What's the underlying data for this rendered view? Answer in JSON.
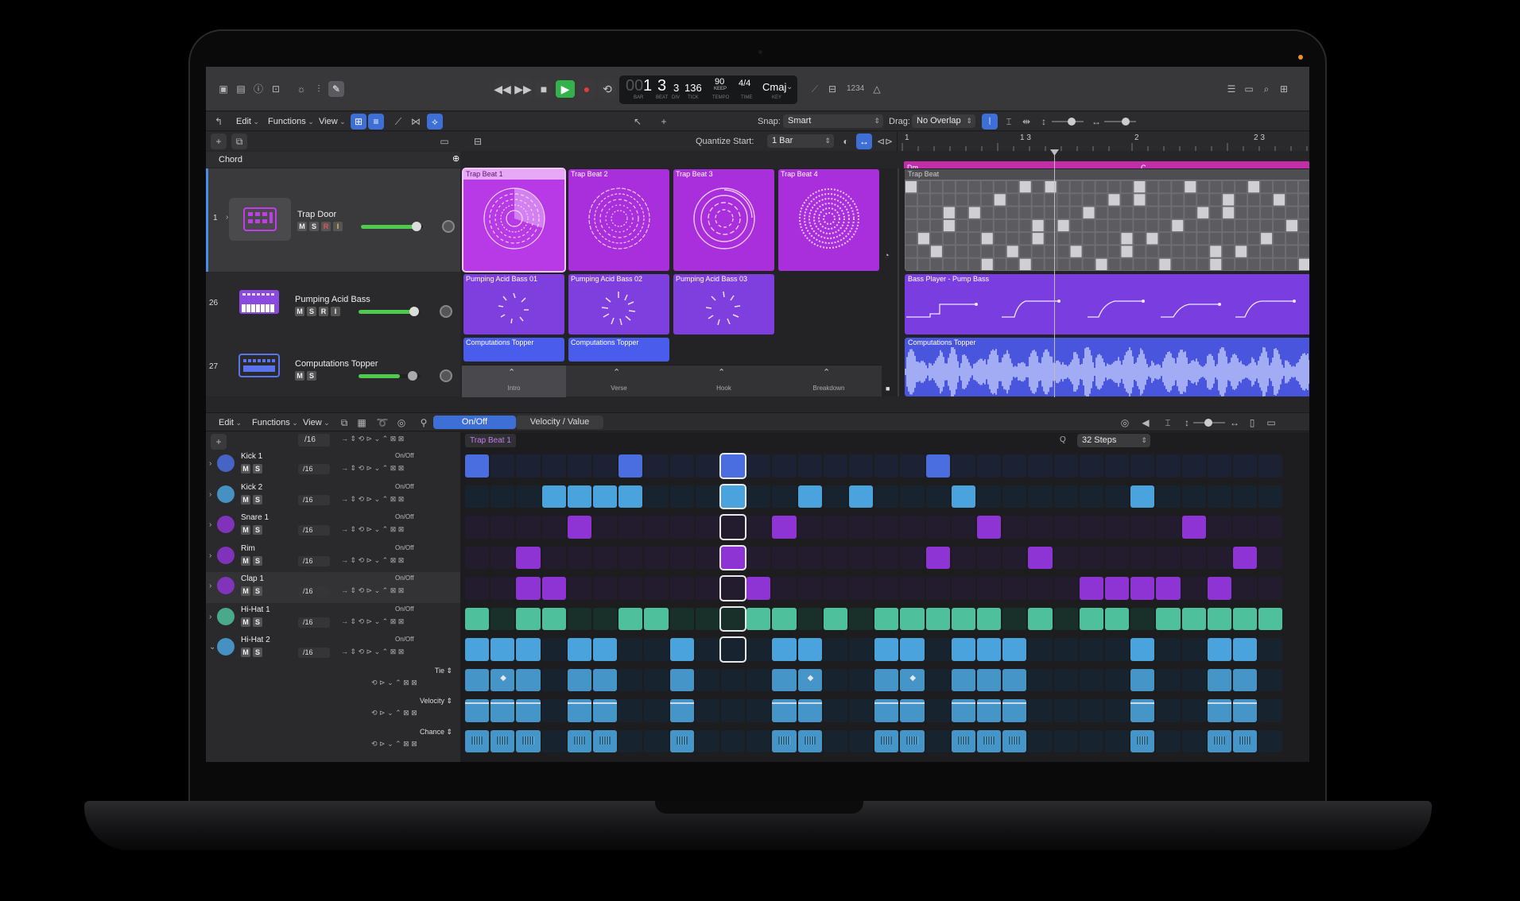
{
  "transport": {
    "position_dim": "00",
    "bar": "1",
    "beat": "3",
    "div": "3",
    "tick": "136",
    "bar_lbl": "BAR",
    "beat_lbl": "BEAT",
    "div_lbl": "DIV",
    "tick_lbl": "TICK",
    "tempo": "90",
    "tempo_mode": "KEEP",
    "tempo_lbl": "TEMPO",
    "time_sig": "4/4",
    "time_lbl": "TIME",
    "key": "Cmaj",
    "key_lbl": "KEY",
    "counter": "1234"
  },
  "toolbar": {
    "edit": "Edit",
    "functions": "Functions",
    "view": "View",
    "snap_label": "Snap:",
    "snap_value": "Smart",
    "drag_label": "Drag:",
    "drag_value": "No Overlap",
    "quantize_label": "Quantize Start:",
    "quantize_value": "1 Bar"
  },
  "chord_track": {
    "label": "Chord",
    "chords": [
      "Dm",
      "C"
    ]
  },
  "ruler": {
    "marks": [
      "1",
      "1 3",
      "2",
      "2 3"
    ]
  },
  "tracks": [
    {
      "number": "1",
      "name": "Trap Door",
      "buttons": [
        "M",
        "S",
        "R",
        "I"
      ],
      "color": "#c03ee8"
    },
    {
      "number": "26",
      "name": "Pumping Acid Bass",
      "buttons": [
        "M",
        "S",
        "R",
        "I"
      ],
      "color": "#8a4ae0"
    },
    {
      "number": "27",
      "name": "Computations Topper",
      "buttons": [
        "M",
        "S"
      ],
      "color": "#5a74ee"
    }
  ],
  "live_loops": {
    "row1": [
      "Trap Beat 1",
      "Trap Beat 2",
      "Trap Beat 3",
      "Trap Beat 4"
    ],
    "row2": [
      "Pumping Acid Bass 01",
      "Pumping Acid Bass 02",
      "Pumping Acid Bass 03"
    ],
    "row3": [
      "Computations Topper",
      "Computations Topper"
    ],
    "scenes": [
      "Intro",
      "Verse",
      "Hook",
      "Breakdown"
    ]
  },
  "regions": {
    "trap": "Trap Beat",
    "bass": "Bass Player - Pump Bass",
    "topper": "Computations Topper"
  },
  "step_editor": {
    "edit": "Edit",
    "functions": "Functions",
    "view": "View",
    "mode_on": "On/Off",
    "mode_vel": "Velocity / Value",
    "pattern_name": "Trap Beat 1",
    "steps": "32 Steps",
    "q_label": "Q",
    "rate": "/16",
    "sub_lanes": [
      "Tie",
      "Velocity",
      "Chance"
    ]
  },
  "rows": [
    {
      "name": "Kick 1",
      "mode": "On/Off",
      "color": "#4a6ee0",
      "off": "#1c2233",
      "steps": [
        0,
        6,
        10,
        18
      ]
    },
    {
      "name": "Kick 2",
      "mode": "On/Off",
      "color": "#4aa3dc",
      "off": "#172430",
      "steps": [
        3,
        4,
        5,
        6,
        10,
        13,
        15,
        19,
        26
      ]
    },
    {
      "name": "Snare 1",
      "mode": "On/Off",
      "color": "#8f34d4",
      "off": "#231b2e",
      "steps": [
        4,
        12,
        20,
        28
      ]
    },
    {
      "name": "Rim",
      "mode": "On/Off",
      "color": "#8f34d4",
      "off": "#231b2e",
      "steps": [
        2,
        10,
        18,
        22,
        30
      ]
    },
    {
      "name": "Clap 1",
      "mode": "On/Off",
      "color": "#8f34d4",
      "off": "#231b2e",
      "steps": [
        2,
        3,
        11,
        24,
        25,
        26,
        27,
        29
      ]
    },
    {
      "name": "Hi-Hat 1",
      "mode": "On/Off",
      "color": "#4ec19c",
      "off": "#19302a",
      "steps": [
        0,
        2,
        3,
        6,
        7,
        11,
        12,
        14,
        16,
        17,
        18,
        19,
        20,
        22,
        24,
        25,
        27,
        28,
        29,
        30,
        31,
        32
      ]
    },
    {
      "name": "Hi-Hat 2",
      "mode": "On/Off",
      "color": "#4aa3dc",
      "off": "#172430",
      "steps": [
        0,
        1,
        2,
        4,
        5,
        8,
        12,
        13,
        16,
        17,
        19,
        20,
        21,
        26,
        29,
        30
      ]
    }
  ],
  "playhead_step": 10
}
